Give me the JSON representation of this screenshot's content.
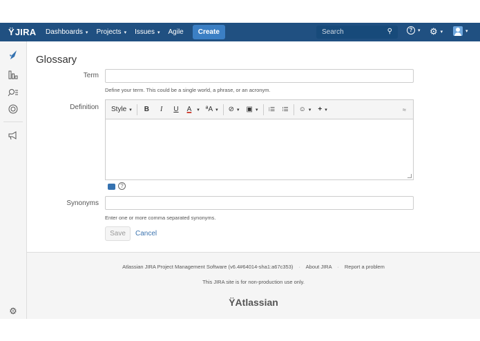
{
  "header": {
    "logo_mark": "Ÿ",
    "logo_text": "JIRA",
    "nav": [
      {
        "label": "Dashboards",
        "caret": "▾"
      },
      {
        "label": "Projects",
        "caret": "▾"
      },
      {
        "label": "Issues",
        "caret": "▾"
      },
      {
        "label": "Agile",
        "caret": ""
      }
    ],
    "create_label": "Create",
    "search_placeholder": "Search",
    "search_glyph": "⚲",
    "help_glyph": "?",
    "settings_glyph": "⚙",
    "caret": "▾",
    "colors": {
      "bar": "#205081",
      "create": "#3b7fc4"
    }
  },
  "sidebar": {
    "icons": [
      "rocket-icon",
      "reports-icon",
      "search-icon",
      "components-icon",
      "announce-icon",
      "gear-icon"
    ]
  },
  "page": {
    "title": "Glossary",
    "term": {
      "label": "Term",
      "value": "",
      "hint": "Define your term. This could be a single world, a phrase, or an acronym."
    },
    "definition": {
      "label": "Definition",
      "toolbar": {
        "style": "Style",
        "bold": "B",
        "italic": "I",
        "underline": "U",
        "color": "A",
        "textsize": "ªA",
        "link": "⊘",
        "image": "▣",
        "bullets": "⁝☰",
        "numbers": "⁞☰",
        "emoji": "☺",
        "plus": "+",
        "collapse": "≈"
      }
    },
    "synonyms": {
      "label": "Synonyms",
      "value": "",
      "hint": "Enter one or more comma separated synonyms."
    },
    "save_label": "Save",
    "cancel_label": "Cancel"
  },
  "footer": {
    "line1_a": "Atlassian JIRA Project Management Software (v6.4#64014-sha1:a67c353)",
    "line1_b": "About JIRA",
    "line1_c": "Report a problem",
    "separator": "·",
    "line2": "This JIRA site is for non-production use only.",
    "logo_text": "Atlassian",
    "logo_mark": "Ÿ"
  }
}
